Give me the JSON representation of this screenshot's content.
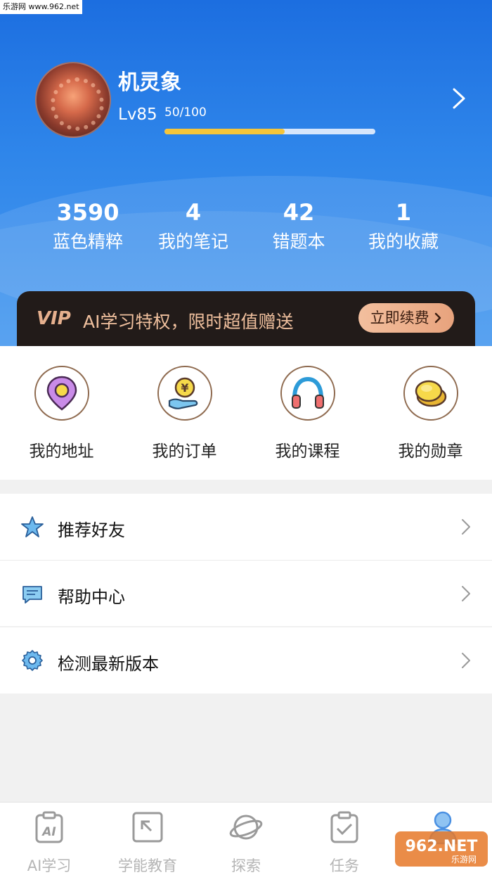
{
  "watermark": "乐游网 www.962.net",
  "profile": {
    "name": "机灵象",
    "level": "Lv85",
    "exp_text": "50/100",
    "exp_progress": 0.57
  },
  "stats": [
    {
      "value": "3590",
      "label": "蓝色精粹"
    },
    {
      "value": "4",
      "label": "我的笔记"
    },
    {
      "value": "42",
      "label": "错题本"
    },
    {
      "value": "1",
      "label": "我的收藏"
    }
  ],
  "vip": {
    "logo": "VIP",
    "text": "AI学习特权，限时超值赠送",
    "button": "立即续费"
  },
  "shortcuts": [
    {
      "label": "我的地址",
      "icon": "location-pin-icon"
    },
    {
      "label": "我的订单",
      "icon": "yen-coin-hand-icon"
    },
    {
      "label": "我的课程",
      "icon": "headphones-icon"
    },
    {
      "label": "我的勋章",
      "icon": "medal-icon"
    }
  ],
  "menu": [
    {
      "label": "推荐好友",
      "icon": "star-icon"
    },
    {
      "label": "帮助中心",
      "icon": "chat-bubble-icon"
    },
    {
      "label": "检测最新版本",
      "icon": "gear-icon"
    }
  ],
  "tabs": [
    {
      "label": "AI学习",
      "icon": "ai-clipboard-icon"
    },
    {
      "label": "学能教育",
      "icon": "arrow-box-icon"
    },
    {
      "label": "探索",
      "icon": "planet-icon"
    },
    {
      "label": "任务",
      "icon": "task-check-icon"
    },
    {
      "label": "",
      "icon": "person-icon"
    }
  ],
  "corner_logo": "962.NET 乐游网",
  "colors": {
    "header_blue": "#2f86ea",
    "exp_fill": "#f5c53a",
    "vip_bg": "#221b19",
    "vip_gold": "#f0c09e",
    "tab_active": "#4a90e2"
  }
}
